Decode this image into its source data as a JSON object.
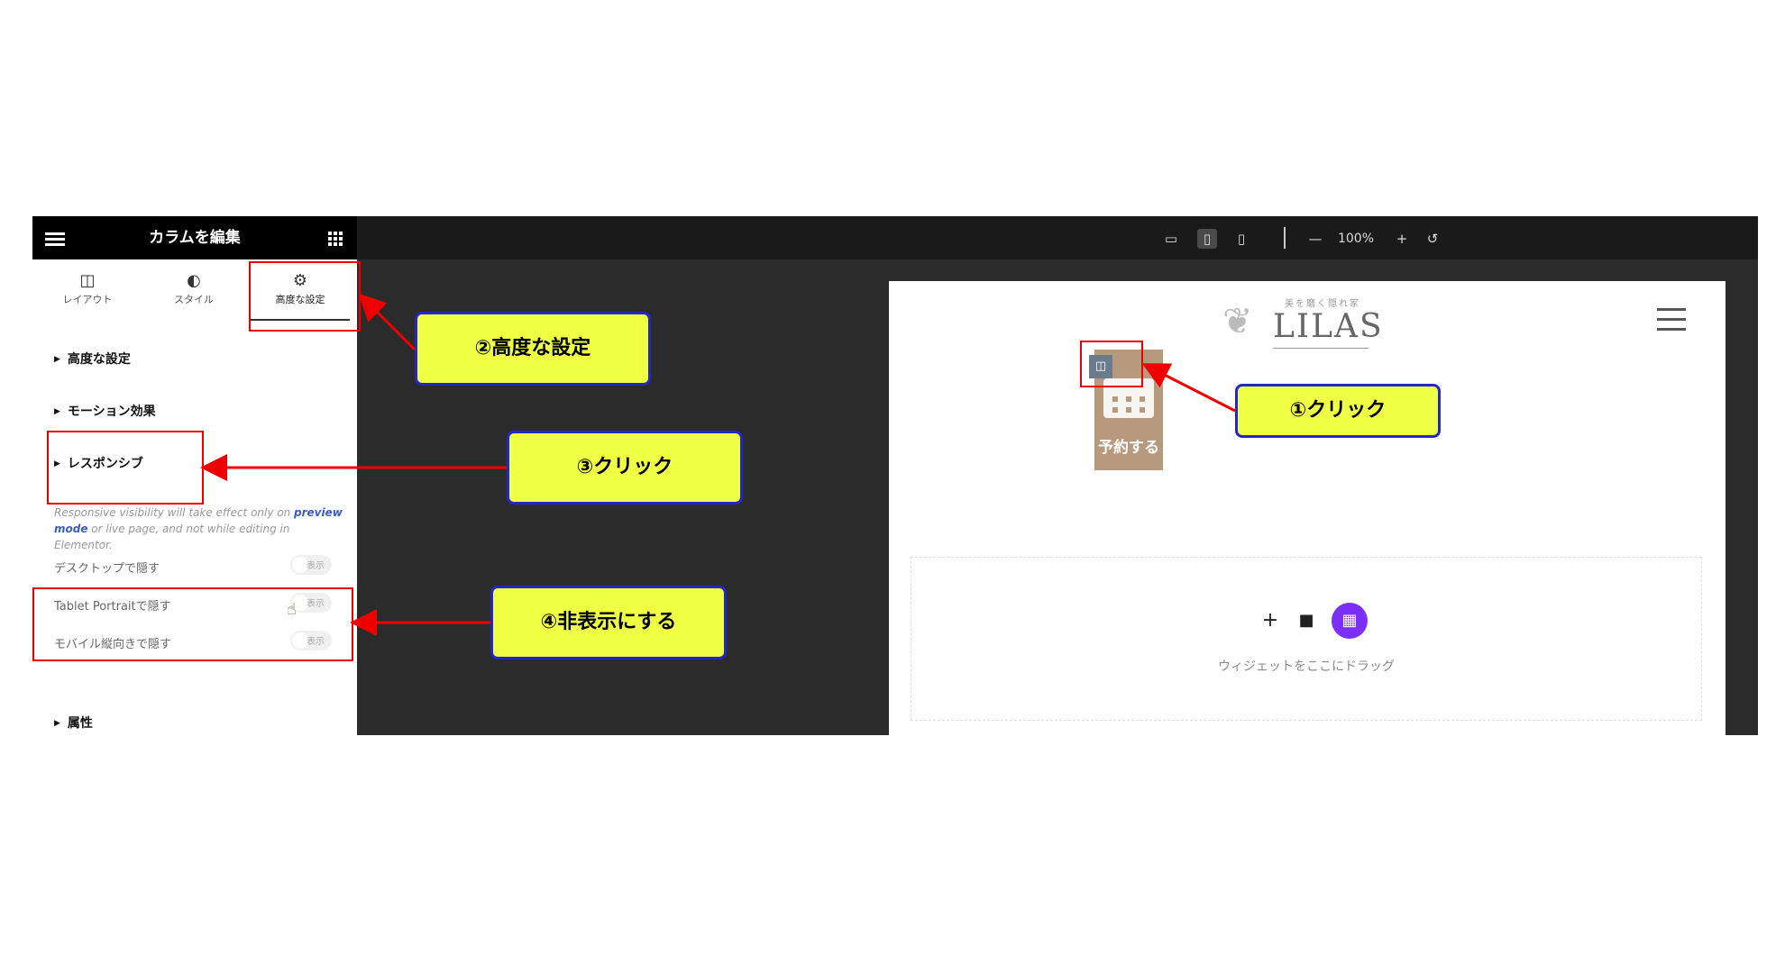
{
  "panel": {
    "title": "カラムを編集",
    "tabs": [
      {
        "label": "レイアウト",
        "icon": "layout-columns-icon"
      },
      {
        "label": "スタイル",
        "icon": "half-circle-icon"
      },
      {
        "label": "高度な設定",
        "icon": "gear-icon"
      }
    ],
    "sections": [
      "高度な設定",
      "モーション効果",
      "レスポンシブ",
      "属性"
    ],
    "note_prefix": "Responsive visibility will take effect only on ",
    "note_link": "preview mode",
    "note_suffix": " or live page, and not while editing in Elementor.",
    "options": [
      {
        "label": "デスクトップで隠す",
        "toggle": "表示"
      },
      {
        "label": "Tablet Portraitで隠す",
        "toggle": "表示"
      },
      {
        "label": "モバイル縦向きで隠す",
        "toggle": "表示"
      }
    ]
  },
  "toolbar": {
    "zoom": "100%",
    "devices": [
      "desktop-icon",
      "tablet-icon",
      "mobile-icon"
    ],
    "active_device": "tablet-icon"
  },
  "preview": {
    "logo_tagline": "美を磨く隠れ家",
    "logo_text": "LILAS",
    "reserve_label": "予約する",
    "dropzone_text": "ウィジェットをここにドラッグ"
  },
  "callouts": {
    "c1": "①クリック",
    "c2": "②高度な設定",
    "c3": "③クリック",
    "c4": "④非表示にする"
  },
  "colors": {
    "annotation_red": "#ee0000",
    "callout_fill": "#eeff44",
    "callout_border": "#2525cc",
    "accent_purple": "#7b2ff7",
    "reserve_brown": "#b79a7e"
  }
}
